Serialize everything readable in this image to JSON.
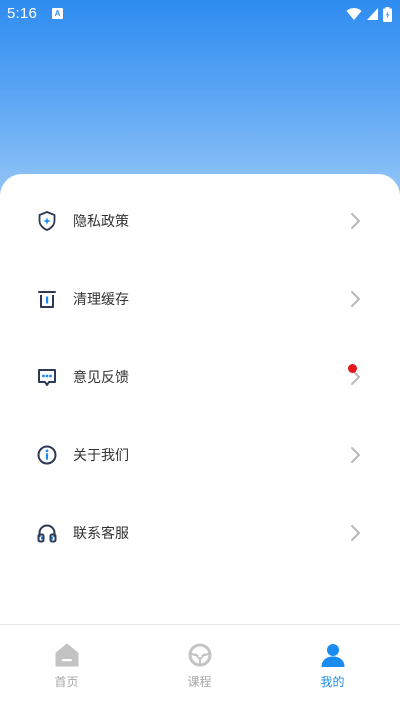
{
  "status_bar": {
    "time": "5:16",
    "notification_badge": "A",
    "icons": [
      "wifi-icon",
      "signal-icon",
      "battery-icon"
    ]
  },
  "menu": {
    "items": [
      {
        "label": "隐私政策",
        "icon": "shield-icon"
      },
      {
        "label": "清理缓存",
        "icon": "trash-icon"
      },
      {
        "label": "意见反馈",
        "icon": "feedback-message-icon",
        "has_red_dot": true
      },
      {
        "label": "关于我们",
        "icon": "info-icon"
      },
      {
        "label": "联系客服",
        "icon": "headset-icon"
      }
    ]
  },
  "tab_bar": {
    "tabs": [
      {
        "label": "首页",
        "icon": "home-icon",
        "active": false
      },
      {
        "label": "课程",
        "icon": "steering-wheel-icon",
        "active": false
      },
      {
        "label": "我的",
        "icon": "user-icon",
        "active": true
      }
    ]
  },
  "colors": {
    "header_gradient_top": "#2e8cf0",
    "header_gradient_bottom": "#a7d0f8",
    "tab_active": "#1a8cf0",
    "tab_inactive": "#a8a8a8",
    "badge_red": "#e5131c",
    "menu_icon_color": "#2d3a55",
    "chevron_color": "#b8b8b8"
  }
}
